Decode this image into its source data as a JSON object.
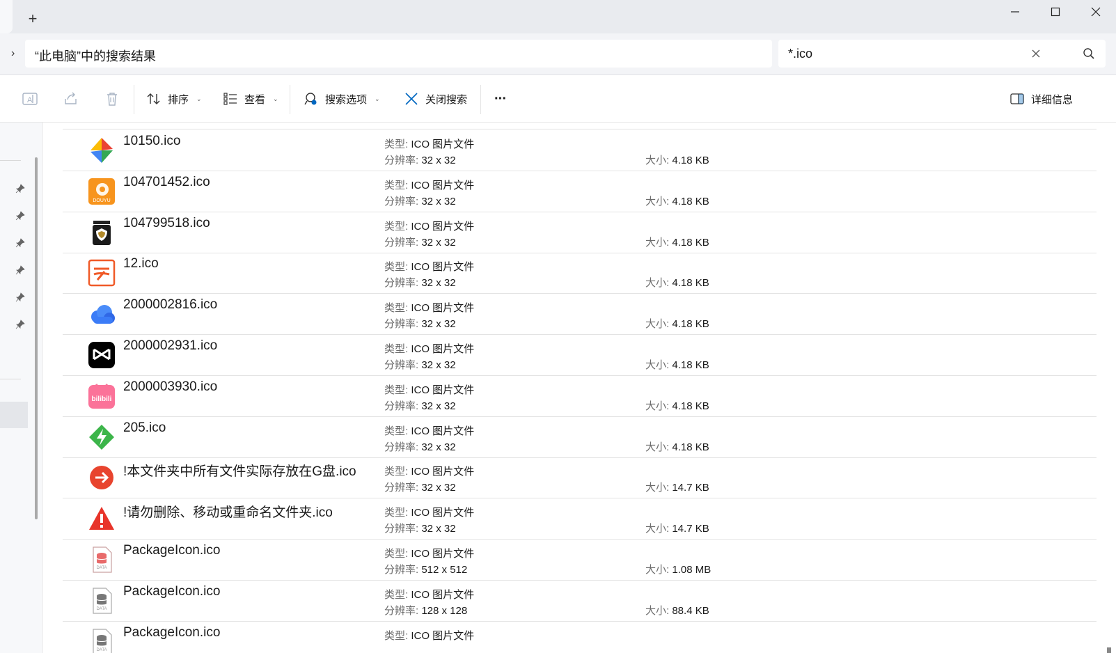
{
  "window": {
    "new_tab_glyph": "+",
    "minimize_icon": "minimize-icon",
    "maximize_icon": "maximize-icon",
    "close_icon": "close-icon"
  },
  "address": {
    "chevron": "›",
    "path": "“此电脑”中的搜索结果"
  },
  "search": {
    "query": "*.ico"
  },
  "toolbar": {
    "sort_label": "排序",
    "view_label": "查看",
    "search_options_label": "搜索选项",
    "close_search_label": "关闭搜索",
    "more_label": "···",
    "details_label": "详细信息"
  },
  "labels": {
    "type": "类型: ",
    "resolution": "分辨率: ",
    "size": "大小: "
  },
  "files": [
    {
      "name": "10150.ico",
      "type": "ICO 图片文件",
      "resolution": "32 x 32",
      "size": "4.18 KB",
      "icon": "puzzle-color-icon"
    },
    {
      "name": "104701452.ico",
      "type": "ICO 图片文件",
      "resolution": "32 x 32",
      "size": "4.18 KB",
      "icon": "douyu-icon"
    },
    {
      "name": "104799518.ico",
      "type": "ICO 图片文件",
      "resolution": "32 x 32",
      "size": "4.18 KB",
      "icon": "dark-shield-icon"
    },
    {
      "name": "12.ico",
      "type": "ICO 图片文件",
      "resolution": "32 x 32",
      "size": "4.18 KB",
      "icon": "orange-logo-icon"
    },
    {
      "name": "2000002816.ico",
      "type": "ICO 图片文件",
      "resolution": "32 x 32",
      "size": "4.18 KB",
      "icon": "cloud-icon"
    },
    {
      "name": "2000002931.ico",
      "type": "ICO 图片文件",
      "resolution": "32 x 32",
      "size": "4.18 KB",
      "icon": "capcut-icon"
    },
    {
      "name": "2000003930.ico",
      "type": "ICO 图片文件",
      "resolution": "32 x 32",
      "size": "4.18 KB",
      "icon": "bilibili-icon"
    },
    {
      "name": "205.ico",
      "type": "ICO 图片文件",
      "resolution": "32 x 32",
      "size": "4.18 KB",
      "icon": "green-bolt-icon"
    },
    {
      "name": "!本文件夹中所有文件实际存放在G盘.ico",
      "type": "ICO 图片文件",
      "resolution": "32 x 32",
      "size": "14.7 KB",
      "icon": "red-arrow-icon"
    },
    {
      "name": "!请勿删除、移动或重命名文件夹.ico",
      "type": "ICO 图片文件",
      "resolution": "32 x 32",
      "size": "14.7 KB",
      "icon": "warning-icon"
    },
    {
      "name": "PackageIcon.ico",
      "type": "ICO 图片文件",
      "resolution": "512 x 512",
      "size": "1.08 MB",
      "icon": "data-package-red-icon"
    },
    {
      "name": "PackageIcon.ico",
      "type": "ICO 图片文件",
      "resolution": "128 x 128",
      "size": "88.4 KB",
      "icon": "data-package-gray-icon"
    },
    {
      "name": "PackageIcon.ico",
      "type": "ICO 图片文件",
      "resolution": "",
      "size": "",
      "icon": "data-package-gray-icon"
    }
  ],
  "colors": {
    "titlebar": "#e9ebef",
    "accent": "#0067c0"
  }
}
